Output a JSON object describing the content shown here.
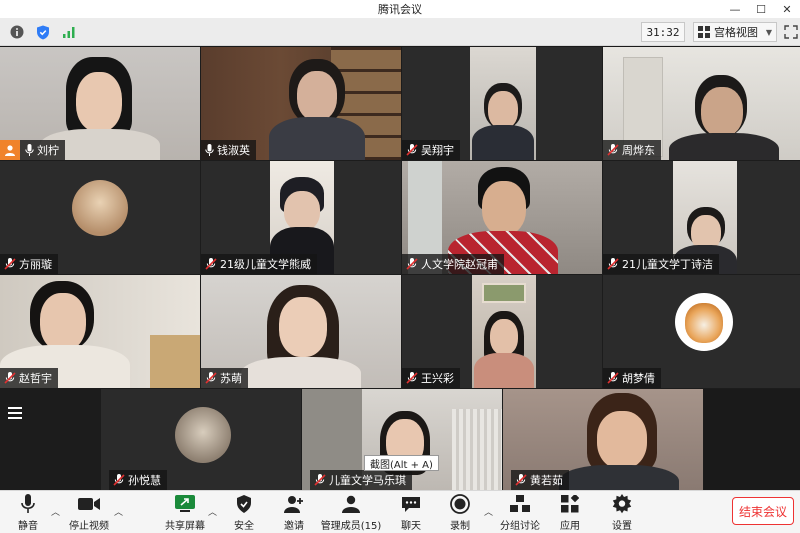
{
  "app": {
    "title": "腾讯会议"
  },
  "window_controls": {
    "minimize": "—",
    "maximize": "☐",
    "close": "✕"
  },
  "topbar": {
    "timer": "31:32",
    "view_label": "宫格视图",
    "icons": [
      "info-icon",
      "security-shield-icon",
      "signal-icon",
      "fullscreen-icon"
    ]
  },
  "participants": [
    {
      "name": "刘柠",
      "host": true
    },
    {
      "name": "钱淑英"
    },
    {
      "name": "吴翔宇"
    },
    {
      "name": "周烨东"
    },
    {
      "name": "方丽璇"
    },
    {
      "name": "21级儿童文学熊威"
    },
    {
      "name": "人文学院赵冠甫"
    },
    {
      "name": "21儿童文学丁诗洁"
    },
    {
      "name": "赵哲宇"
    },
    {
      "name": "苏萌"
    },
    {
      "name": "王兴彩"
    },
    {
      "name": "胡梦倩"
    },
    {
      "name": "孙悦慧"
    },
    {
      "name": "儿童文学马乐琪"
    },
    {
      "name": "黄若茹"
    }
  ],
  "tooltip": "截图(Alt + A)",
  "toolbar": {
    "mute": "静音",
    "stop_video": "停止视频",
    "share_screen": "共享屏幕",
    "security": "安全",
    "invite": "邀请",
    "manage_members": "管理成员(15)",
    "chat": "聊天",
    "record": "录制",
    "breakout": "分组讨论",
    "apps": "应用",
    "settings": "设置",
    "end_meeting": "结束会议"
  },
  "colors": {
    "end_meeting": "#e33333",
    "host_badge": "#f0832b",
    "mic_muted": "#e03131"
  }
}
